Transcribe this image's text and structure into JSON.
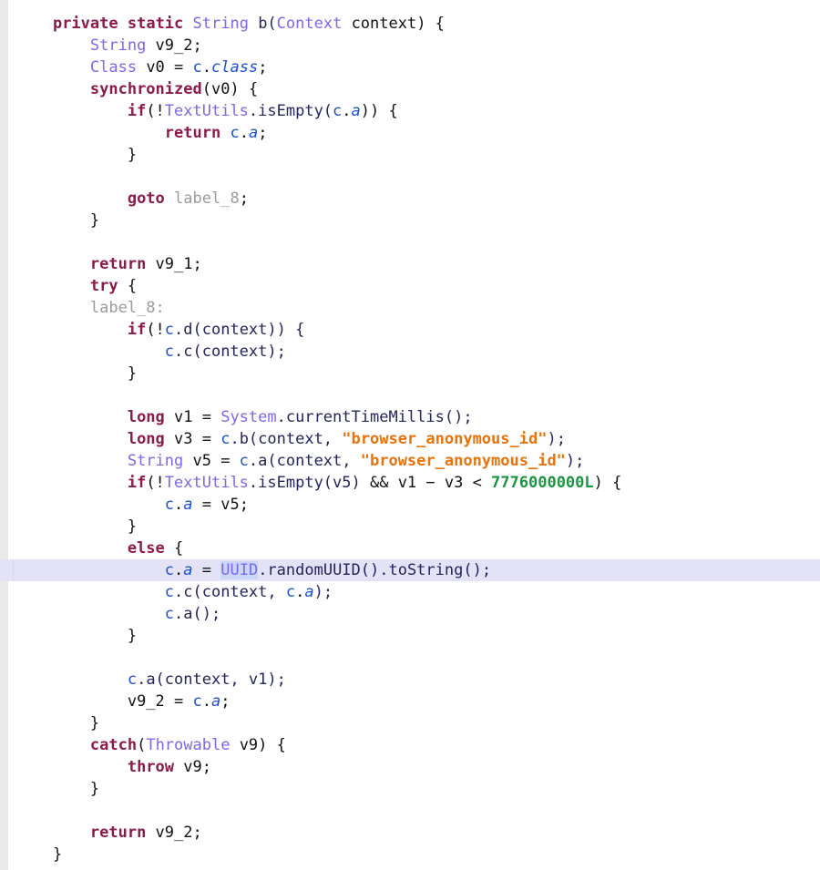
{
  "viewer": {
    "name": "decompiled-java-source",
    "title": "Decompiled Java Source View",
    "background_color": "#ffffff",
    "gutter_color": "#e9e9e9",
    "current_line_highlight_color": "#e4e2f7",
    "selection_highlight_color": "#c9d6f5",
    "current_line_index": 26,
    "selected_token": "UUID",
    "line_count": 38
  },
  "palette": {
    "keyword": "#8a1b4a",
    "type": "#7b68ee",
    "identifier": "#1a4fd6",
    "field_italic": "#1a4fd6",
    "method": "#24245e",
    "plain": "#111111",
    "string": "#e8730c",
    "number": "#1a9641",
    "label": "#9b9b9b"
  },
  "code": {
    "language": "java",
    "lines": [
      {
        "n": 1,
        "indent": 1,
        "tokens": [
          {
            "t": "private",
            "c": "kw"
          },
          {
            "t": " ",
            "c": "plain"
          },
          {
            "t": "static",
            "c": "kw"
          },
          {
            "t": " ",
            "c": "plain"
          },
          {
            "t": "String",
            "c": "type"
          },
          {
            "t": " b(",
            "c": "method"
          },
          {
            "t": "Context",
            "c": "type"
          },
          {
            "t": " context) {",
            "c": "plain"
          }
        ]
      },
      {
        "n": 2,
        "indent": 2,
        "tokens": [
          {
            "t": "String",
            "c": "type"
          },
          {
            "t": " v9_2;",
            "c": "plain"
          }
        ]
      },
      {
        "n": 3,
        "indent": 2,
        "tokens": [
          {
            "t": "Class",
            "c": "type"
          },
          {
            "t": " v0 = ",
            "c": "plain"
          },
          {
            "t": "c",
            "c": "ident"
          },
          {
            "t": ".",
            "c": "plain"
          },
          {
            "t": "class",
            "c": "field"
          },
          {
            "t": ";",
            "c": "plain"
          }
        ]
      },
      {
        "n": 4,
        "indent": 2,
        "tokens": [
          {
            "t": "synchronized",
            "c": "kw"
          },
          {
            "t": "(v0) {",
            "c": "plain"
          }
        ]
      },
      {
        "n": 5,
        "indent": 3,
        "tokens": [
          {
            "t": "if",
            "c": "kw"
          },
          {
            "t": "(!",
            "c": "plain"
          },
          {
            "t": "TextUtils",
            "c": "type"
          },
          {
            "t": ".isEmpty(",
            "c": "method"
          },
          {
            "t": "c",
            "c": "ident"
          },
          {
            "t": ".",
            "c": "plain"
          },
          {
            "t": "a",
            "c": "field"
          },
          {
            "t": ")) {",
            "c": "plain"
          }
        ]
      },
      {
        "n": 6,
        "indent": 4,
        "tokens": [
          {
            "t": "return",
            "c": "kw"
          },
          {
            "t": " ",
            "c": "plain"
          },
          {
            "t": "c",
            "c": "ident"
          },
          {
            "t": ".",
            "c": "plain"
          },
          {
            "t": "a",
            "c": "field"
          },
          {
            "t": ";",
            "c": "plain"
          }
        ]
      },
      {
        "n": 7,
        "indent": 3,
        "tokens": [
          {
            "t": "}",
            "c": "plain"
          }
        ]
      },
      {
        "n": 8,
        "indent": 0,
        "blank": true,
        "tokens": []
      },
      {
        "n": 9,
        "indent": 3,
        "tokens": [
          {
            "t": "goto",
            "c": "kw"
          },
          {
            "t": " ",
            "c": "plain"
          },
          {
            "t": "label_8",
            "c": "label"
          },
          {
            "t": ";",
            "c": "plain"
          }
        ]
      },
      {
        "n": 10,
        "indent": 2,
        "tokens": [
          {
            "t": "}",
            "c": "plain"
          }
        ]
      },
      {
        "n": 11,
        "indent": 0,
        "blank": true,
        "tokens": []
      },
      {
        "n": 12,
        "indent": 2,
        "tokens": [
          {
            "t": "return",
            "c": "kw"
          },
          {
            "t": " v9_1;",
            "c": "plain"
          }
        ]
      },
      {
        "n": 13,
        "indent": 2,
        "tokens": [
          {
            "t": "try",
            "c": "kw"
          },
          {
            "t": " {",
            "c": "plain"
          }
        ]
      },
      {
        "n": 14,
        "indent": 2,
        "tokens": [
          {
            "t": "label_8",
            "c": "label"
          },
          {
            "t": ":",
            "c": "label"
          }
        ]
      },
      {
        "n": 15,
        "indent": 3,
        "tokens": [
          {
            "t": "if",
            "c": "kw"
          },
          {
            "t": "(!",
            "c": "plain"
          },
          {
            "t": "c",
            "c": "ident"
          },
          {
            "t": ".d(context)) {",
            "c": "method"
          }
        ]
      },
      {
        "n": 16,
        "indent": 4,
        "tokens": [
          {
            "t": "c",
            "c": "ident"
          },
          {
            "t": ".c(context);",
            "c": "method"
          }
        ]
      },
      {
        "n": 17,
        "indent": 3,
        "tokens": [
          {
            "t": "}",
            "c": "plain"
          }
        ]
      },
      {
        "n": 18,
        "indent": 0,
        "blank": true,
        "tokens": []
      },
      {
        "n": 19,
        "indent": 3,
        "tokens": [
          {
            "t": "long",
            "c": "kw"
          },
          {
            "t": " v1 = ",
            "c": "plain"
          },
          {
            "t": "System",
            "c": "type"
          },
          {
            "t": ".currentTimeMillis();",
            "c": "method"
          }
        ]
      },
      {
        "n": 20,
        "indent": 3,
        "tokens": [
          {
            "t": "long",
            "c": "kw"
          },
          {
            "t": " v3 = ",
            "c": "plain"
          },
          {
            "t": "c",
            "c": "ident"
          },
          {
            "t": ".b(context, ",
            "c": "method"
          },
          {
            "t": "\"browser_anonymous_id\"",
            "c": "str"
          },
          {
            "t": ");",
            "c": "method"
          }
        ]
      },
      {
        "n": 21,
        "indent": 3,
        "tokens": [
          {
            "t": "String",
            "c": "type"
          },
          {
            "t": " v5 = ",
            "c": "plain"
          },
          {
            "t": "c",
            "c": "ident"
          },
          {
            "t": ".a(context, ",
            "c": "method"
          },
          {
            "t": "\"browser_anonymous_id\"",
            "c": "str"
          },
          {
            "t": ");",
            "c": "method"
          }
        ]
      },
      {
        "n": 22,
        "indent": 3,
        "tokens": [
          {
            "t": "if",
            "c": "kw"
          },
          {
            "t": "(!",
            "c": "plain"
          },
          {
            "t": "TextUtils",
            "c": "type"
          },
          {
            "t": ".isEmpty(v5)",
            "c": "method"
          },
          {
            "t": " && v1 − v3 < ",
            "c": "plain"
          },
          {
            "t": "7776000000L",
            "c": "num"
          },
          {
            "t": ") {",
            "c": "plain"
          }
        ]
      },
      {
        "n": 23,
        "indent": 4,
        "tokens": [
          {
            "t": "c",
            "c": "ident"
          },
          {
            "t": ".",
            "c": "plain"
          },
          {
            "t": "a",
            "c": "field"
          },
          {
            "t": " = v5;",
            "c": "plain"
          }
        ]
      },
      {
        "n": 24,
        "indent": 3,
        "tokens": [
          {
            "t": "}",
            "c": "plain"
          }
        ]
      },
      {
        "n": 25,
        "indent": 3,
        "tokens": [
          {
            "t": "else",
            "c": "kw"
          },
          {
            "t": " {",
            "c": "plain"
          }
        ]
      },
      {
        "n": 26,
        "indent": 4,
        "current": true,
        "tokens": [
          {
            "t": "c",
            "c": "ident"
          },
          {
            "t": ".",
            "c": "plain"
          },
          {
            "t": "a",
            "c": "field"
          },
          {
            "t": " = ",
            "c": "plain"
          },
          {
            "t": "UUID",
            "c": "type",
            "sel": true
          },
          {
            "t": ".randomUUID().toString();",
            "c": "method"
          }
        ]
      },
      {
        "n": 27,
        "indent": 4,
        "tokens": [
          {
            "t": "c",
            "c": "ident"
          },
          {
            "t": ".c(context, ",
            "c": "method"
          },
          {
            "t": "c",
            "c": "ident"
          },
          {
            "t": ".",
            "c": "plain"
          },
          {
            "t": "a",
            "c": "field"
          },
          {
            "t": ");",
            "c": "method"
          }
        ]
      },
      {
        "n": 28,
        "indent": 4,
        "tokens": [
          {
            "t": "c",
            "c": "ident"
          },
          {
            "t": ".a();",
            "c": "method"
          }
        ]
      },
      {
        "n": 29,
        "indent": 3,
        "tokens": [
          {
            "t": "}",
            "c": "plain"
          }
        ]
      },
      {
        "n": 30,
        "indent": 0,
        "blank": true,
        "tokens": []
      },
      {
        "n": 31,
        "indent": 3,
        "tokens": [
          {
            "t": "c",
            "c": "ident"
          },
          {
            "t": ".a(context, v1);",
            "c": "method"
          }
        ]
      },
      {
        "n": 32,
        "indent": 3,
        "tokens": [
          {
            "t": "v9_2 = ",
            "c": "plain"
          },
          {
            "t": "c",
            "c": "ident"
          },
          {
            "t": ".",
            "c": "plain"
          },
          {
            "t": "a",
            "c": "field"
          },
          {
            "t": ";",
            "c": "plain"
          }
        ]
      },
      {
        "n": 33,
        "indent": 2,
        "tokens": [
          {
            "t": "}",
            "c": "plain"
          }
        ]
      },
      {
        "n": 34,
        "indent": 2,
        "tokens": [
          {
            "t": "catch",
            "c": "kw"
          },
          {
            "t": "(",
            "c": "plain"
          },
          {
            "t": "Throwable",
            "c": "type"
          },
          {
            "t": " v9) {",
            "c": "plain"
          }
        ]
      },
      {
        "n": 35,
        "indent": 3,
        "tokens": [
          {
            "t": "throw",
            "c": "kw"
          },
          {
            "t": " v9;",
            "c": "plain"
          }
        ]
      },
      {
        "n": 36,
        "indent": 2,
        "tokens": [
          {
            "t": "}",
            "c": "plain"
          }
        ]
      },
      {
        "n": 37,
        "indent": 0,
        "blank": true,
        "tokens": []
      },
      {
        "n": 38,
        "indent": 2,
        "tokens": [
          {
            "t": "return",
            "c": "kw"
          },
          {
            "t": " v9_2;",
            "c": "plain"
          }
        ]
      },
      {
        "n": 39,
        "indent": 1,
        "tokens": [
          {
            "t": "}",
            "c": "plain"
          }
        ]
      }
    ]
  }
}
